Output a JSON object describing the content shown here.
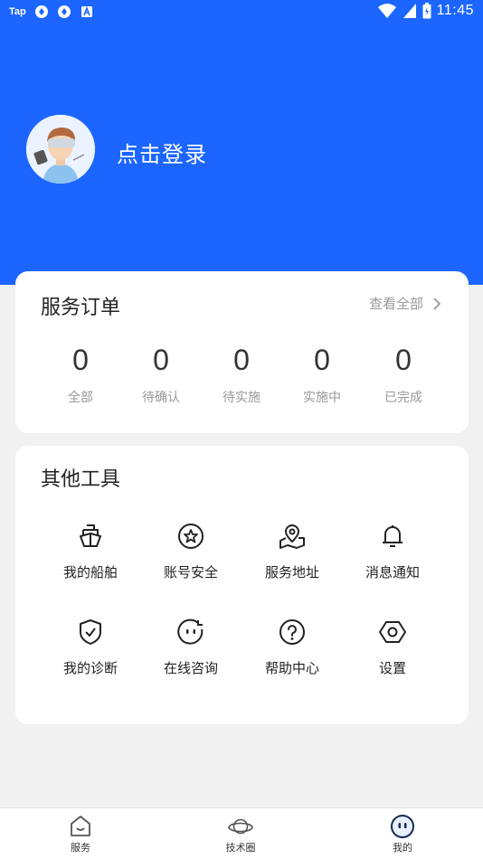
{
  "status_bar": {
    "left_label": "Tap",
    "time": "11:45",
    "icons": [
      "notification-icon",
      "notification-icon",
      "a-icon",
      "wifi-icon",
      "signal-icon",
      "battery-icon"
    ]
  },
  "profile": {
    "login_text": "点击登录"
  },
  "orders": {
    "title": "服务订单",
    "view_all": "查看全部",
    "items": [
      {
        "count": "0",
        "label": "全部"
      },
      {
        "count": "0",
        "label": "待确认"
      },
      {
        "count": "0",
        "label": "待实施"
      },
      {
        "count": "0",
        "label": "实施中"
      },
      {
        "count": "0",
        "label": "已完成"
      }
    ]
  },
  "tools": {
    "title": "其他工具",
    "items": [
      {
        "label": "我的船舶",
        "icon": "ship-icon"
      },
      {
        "label": "账号安全",
        "icon": "star-shield-icon"
      },
      {
        "label": "服务地址",
        "icon": "location-icon"
      },
      {
        "label": "消息通知",
        "icon": "bell-icon"
      },
      {
        "label": "我的诊断",
        "icon": "check-shield-icon"
      },
      {
        "label": "在线咨询",
        "icon": "chat-face-icon"
      },
      {
        "label": "帮助中心",
        "icon": "help-icon"
      },
      {
        "label": "设置",
        "icon": "settings-icon"
      }
    ]
  },
  "tabbar": {
    "items": [
      {
        "label": "服务",
        "icon": "service-icon"
      },
      {
        "label": "技术圈",
        "icon": "planet-icon"
      },
      {
        "label": "我的",
        "icon": "me-icon",
        "active": true
      }
    ]
  },
  "colors": {
    "brand": "#1c66ff",
    "background": "#f1f1f1"
  }
}
